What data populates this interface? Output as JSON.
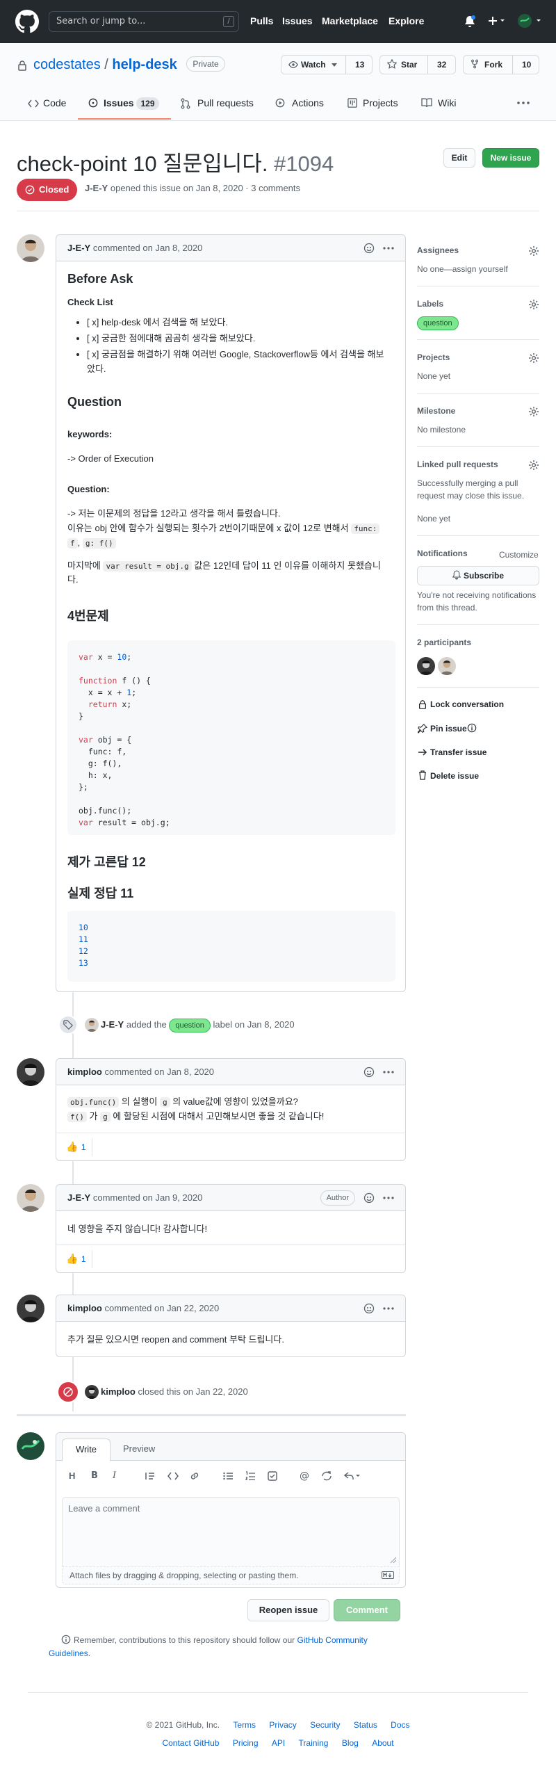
{
  "header": {
    "search_placeholder": "Search or jump to...",
    "slash": "/",
    "nav": [
      "Pulls",
      "Issues",
      "Marketplace",
      "Explore"
    ]
  },
  "repo": {
    "owner": "codestates",
    "sep": "/",
    "name": "help-desk",
    "visibility": "Private",
    "watch_label": "Watch",
    "watch_count": "13",
    "star_label": "Star",
    "star_count": "32",
    "fork_label": "Fork",
    "fork_count": "10"
  },
  "tabs": {
    "code": "Code",
    "issues": "Issues",
    "issues_count": "129",
    "pulls": "Pull requests",
    "actions": "Actions",
    "projects": "Projects",
    "wiki": "Wiki"
  },
  "issue": {
    "title": "check-point 10 질문입니다.",
    "number": "#1094",
    "edit": "Edit",
    "new_issue": "New issue",
    "status": "Closed",
    "author": "J-E-Y",
    "meta": "opened this issue on Jan 8, 2020 · 3 comments"
  },
  "comment1": {
    "author": "J-E-Y",
    "time": "commented on Jan 8, 2020",
    "h_before": "Before Ask",
    "checklist_title": "Check List",
    "checks": [
      "[ x] help-desk 에서 검색을 해 보았다.",
      "[ x] 궁금한 점에대해 곰곰히 생각을 해보았다.",
      "[ x] 궁금점을 해결하기 위해 여러번 Google, Stackoverflow등 에서 검색을 해보",
      "았다."
    ],
    "h_question": "Question",
    "kw_label": "keywords:",
    "kw_text": "-> Order of Execution",
    "q_label": "Question:",
    "q_line1": "-> 저는 이문제의 정답을 12라고 생각을 해서 틀렸습니다.",
    "q_line2a": "이유는 obj 안에 함수가 실행되는 횟수가 2번이기때문에 x 값이 12로 변해서",
    "q_code1": "func:",
    "q_line3a": "f",
    "q_code2": "g: f()",
    "q_line4a": "마지막에",
    "q_code3": "var result = obj.g",
    "q_line4b": "값은 12인데 답이 11 인 이유를 이해하지 못했습니",
    "q_line5": "다.",
    "h_problem": "4번문제",
    "h_my": "제가 고른답 12",
    "h_real": "실제 정답 11",
    "code_out": [
      "10",
      "11",
      "12",
      "13"
    ]
  },
  "event1": {
    "actor": "J-E-Y",
    "added": "added the",
    "label": "question",
    "suffix": "label on Jan 8, 2020"
  },
  "comment2": {
    "author": "kimploo",
    "time": "commented on Jan 8, 2020",
    "code1": "obj.func()",
    "t1": "의 실행이",
    "code2": "g",
    "t2": "의 value값에 영향이 있었을까요?",
    "code3": "f()",
    "t3": "가",
    "code4": "g",
    "t4": "에 할당된 시점에 대해서 고민해보시면 좋을 것 같습니다!",
    "reaction": "👍",
    "count": "1"
  },
  "comment3": {
    "author": "J-E-Y",
    "time": "commented on Jan 9, 2020",
    "badge": "Author",
    "body": "네 영향을 주지 않습니다! 감사합니다!",
    "reaction": "👍",
    "count": "1"
  },
  "comment4": {
    "author": "kimploo",
    "time": "commented on Jan 22, 2020",
    "body": "추가 질문 있으시면 reopen and comment 부탁 드립니다."
  },
  "event2": {
    "actor": "kimploo",
    "text": "closed this on Jan 22, 2020"
  },
  "composer": {
    "tab_write": "Write",
    "tab_preview": "Preview",
    "placeholder": "Leave a comment",
    "attach": "Attach files by dragging & dropping, selecting or pasting them.",
    "reopen": "Reopen issue",
    "comment": "Comment",
    "remember": "Remember, contributions to this repository should follow our",
    "guidelines1": "GitHub Community",
    "guidelines2": "Guidelines."
  },
  "sidebar": {
    "assignees": "Assignees",
    "assignees_val": "No one—assign yourself",
    "labels": "Labels",
    "label_q": "question",
    "projects": "Projects",
    "projects_val": "None yet",
    "milestone": "Milestone",
    "milestone_val": "No milestone",
    "linked": "Linked pull requests",
    "linked_desc1": "Successfully merging a pull",
    "linked_desc2": "request may close this issue.",
    "linked_val": "None yet",
    "notifications": "Notifications",
    "customize": "Customize",
    "subscribe": "Subscribe",
    "notif_desc1": "You're not receiving notifications",
    "notif_desc2": "from this thread.",
    "participants": "2 participants",
    "lock": "Lock conversation",
    "pin": "Pin issue",
    "transfer": "Transfer issue",
    "delete": "Delete issue"
  },
  "footer": {
    "copyright": "© 2021 GitHub, Inc.",
    "row1": [
      "Terms",
      "Privacy",
      "Security",
      "Status",
      "Docs"
    ],
    "row2": [
      "Contact GitHub",
      "Pricing",
      "API",
      "Training",
      "Blog",
      "About"
    ]
  },
  "colors": {
    "header_bg": "#24292e",
    "closed": "#d73a49",
    "green": "#2ea44f",
    "link": "#0366d6",
    "label": "#7ee68f"
  }
}
